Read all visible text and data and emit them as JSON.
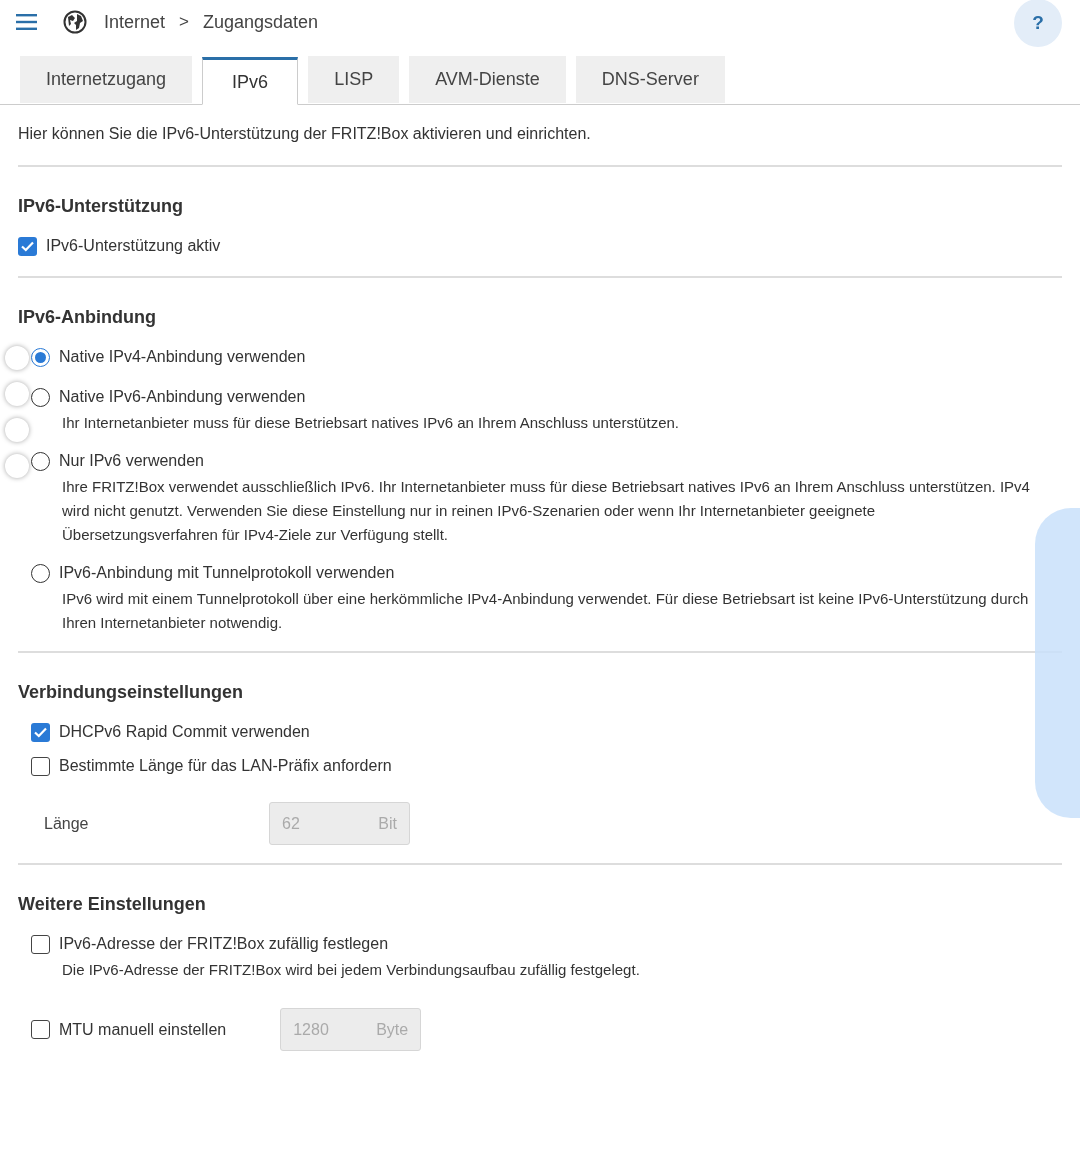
{
  "header": {
    "breadcrumb": [
      "Internet",
      "Zugangsdaten"
    ],
    "separator": ">",
    "help": "?"
  },
  "tabs": [
    {
      "label": "Internetzugang",
      "selected": false
    },
    {
      "label": "IPv6",
      "selected": true
    },
    {
      "label": "LISP",
      "selected": false
    },
    {
      "label": "AVM-Dienste",
      "selected": false
    },
    {
      "label": "DNS-Server",
      "selected": false
    }
  ],
  "intro": "Hier können Sie die IPv6-Unterstützung der FRITZ!Box aktivieren und einrichten.",
  "sections": [
    {
      "title": "IPv6-Unterstützung",
      "items": [
        {
          "kind": "checkbox",
          "label": "IPv6-Unterstützung aktiv",
          "checked": true
        }
      ]
    },
    {
      "title": "IPv6-Anbindung",
      "items": [
        {
          "kind": "radio",
          "label": "Native IPv4-Anbindung verwenden",
          "selected": true
        },
        {
          "kind": "radio",
          "label": "Native IPv6-Anbindung verwenden",
          "selected": false,
          "description": "Ihr Internetanbieter muss für diese Betriebsart natives IPv6 an Ihrem Anschluss unterstützen."
        },
        {
          "kind": "radio",
          "label": "Nur IPv6 verwenden",
          "selected": false,
          "description": "Ihre FRITZ!Box verwendet ausschließlich IPv6. Ihr Internetanbieter muss für diese Betriebsart natives IPv6 an Ihrem Anschluss unterstützen. IPv4 wird nicht genutzt. Verwenden Sie diese Einstellung nur in reinen IPv6-Szenarien oder wenn Ihr Internetanbieter geeignete Übersetzungsverfahren für IPv4-Ziele zur Verfügung stellt."
        },
        {
          "kind": "radio",
          "label": "IPv6-Anbindung mit Tunnelprotokoll verwenden",
          "selected": false,
          "description": "IPv6 wird mit einem Tunnelprotokoll über eine herkömmliche IPv4-Anbindung verwendet. Für diese Betriebsart ist keine IPv6-Unterstützung durch Ihren Internetanbieter notwendig."
        }
      ]
    },
    {
      "title": "Verbindungseinstellungen",
      "items": [
        {
          "kind": "checkbox",
          "label": "DHCPv6 Rapid Commit verwenden",
          "checked": true
        },
        {
          "kind": "checkbox",
          "label": "Bestimmte Länge für das LAN-Präfix anfordern",
          "checked": false
        },
        {
          "kind": "field",
          "label": "Länge",
          "value": "62",
          "unit": "Bit",
          "disabled": true
        }
      ]
    },
    {
      "title": "Weitere Einstellungen",
      "items": [
        {
          "kind": "checkbox",
          "label": "IPv6-Adresse der FRITZ!Box zufällig festlegen",
          "checked": false,
          "description": "Die IPv6-Adresse der FRITZ!Box wird bei jedem Verbindungsaufbau zufällig festgelegt."
        },
        {
          "kind": "checkbox_field",
          "label": "MTU manuell einstellen",
          "checked": false,
          "value": "1280",
          "unit": "Byte",
          "disabled": true
        }
      ]
    }
  ]
}
